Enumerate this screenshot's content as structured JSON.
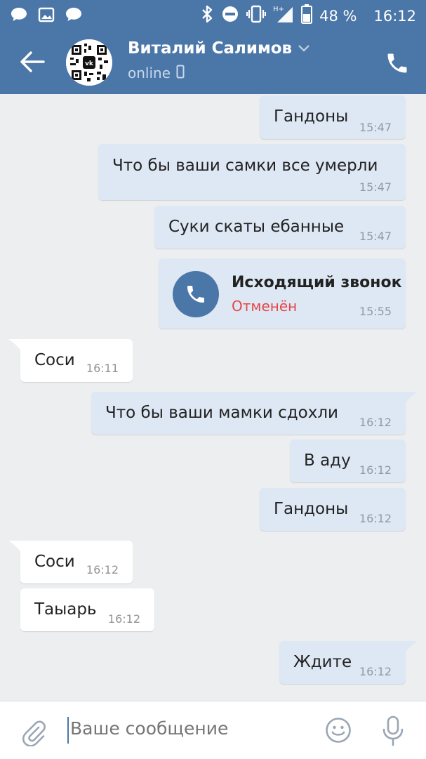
{
  "status_bar": {
    "battery": "48 %",
    "time": "16:12",
    "network": "H+"
  },
  "header": {
    "contact_name": "Виталий Салимов",
    "status": "online"
  },
  "messages": [
    {
      "direction": "out",
      "text": "Гандоны",
      "time": "15:47"
    },
    {
      "direction": "out",
      "text": "Что бы ваши самки все умерли",
      "time": "15:47"
    },
    {
      "direction": "out",
      "text": "Суки скаты ебанные",
      "time": "15:47"
    },
    {
      "direction": "out",
      "type": "call",
      "title": "Исходящий звонок",
      "status": "Отменён",
      "time": "15:55"
    },
    {
      "direction": "in",
      "text": "Соси",
      "time": "16:11"
    },
    {
      "direction": "out",
      "text": "Что бы ваши мамки сдохли",
      "time": "16:12"
    },
    {
      "direction": "out",
      "text": "В аду",
      "time": "16:12"
    },
    {
      "direction": "out",
      "text": "Гандоны",
      "time": "16:12"
    },
    {
      "direction": "in",
      "text": "Соси",
      "time": "16:12"
    },
    {
      "direction": "in",
      "text": "Таыарь",
      "time": "16:12"
    },
    {
      "direction": "out",
      "text": "Ждите",
      "time": "16:12"
    }
  ],
  "composer": {
    "placeholder": "Ваше сообщение"
  },
  "colors": {
    "brand": "#4a76a8",
    "outgoing_bubble": "#dee8f4",
    "incoming_bubble": "#ffffff",
    "background": "#edeef0",
    "cancelled": "#e64646"
  },
  "icons": [
    "chat-icon",
    "image-icon",
    "chat-icon",
    "bluetooth-icon",
    "do-not-disturb-icon",
    "vibrate-icon",
    "signal-icon",
    "battery-icon",
    "back-arrow-icon",
    "chevron-down-icon",
    "mobile-icon",
    "phone-icon",
    "paperclip-icon",
    "emoji-icon",
    "microphone-icon"
  ]
}
